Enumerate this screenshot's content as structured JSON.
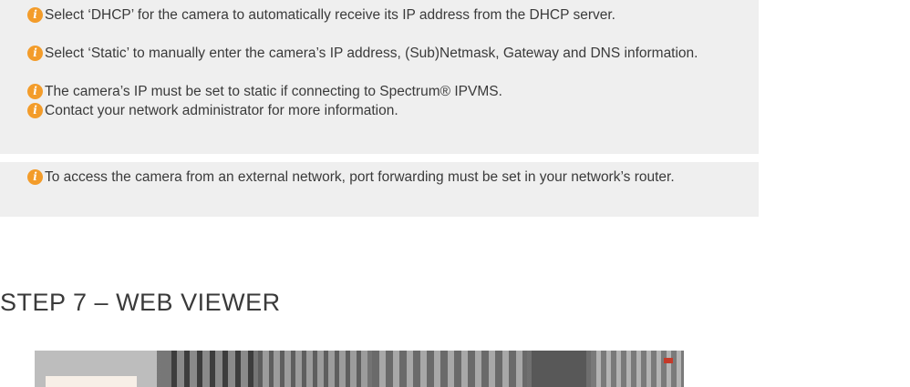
{
  "notes_primary": [
    {
      "icon": "info-icon",
      "text": "Select ‘DHCP’ for the camera to automatically receive its IP address from the DHCP server."
    },
    {
      "icon": "info-icon",
      "text": "Select ‘Static’ to manually enter the camera’s IP address, (Sub)Netmask, Gateway and DNS information."
    },
    {
      "icon": "info-icon",
      "text": "The camera’s IP must be set to static if connecting to Spectrum® IPVMS."
    },
    {
      "icon": "info-icon",
      "text": "Contact your network administrator for more information."
    }
  ],
  "notes_secondary": [
    {
      "icon": "info-icon",
      "text": "To access the camera from an external network, port forwarding must be set in your network’s router."
    }
  ],
  "step_heading": "STEP 7 – WEB VIEWER",
  "colors": {
    "note_background": "#efefef",
    "info_icon": "#f39c2a",
    "text": "#3a3a3a"
  }
}
